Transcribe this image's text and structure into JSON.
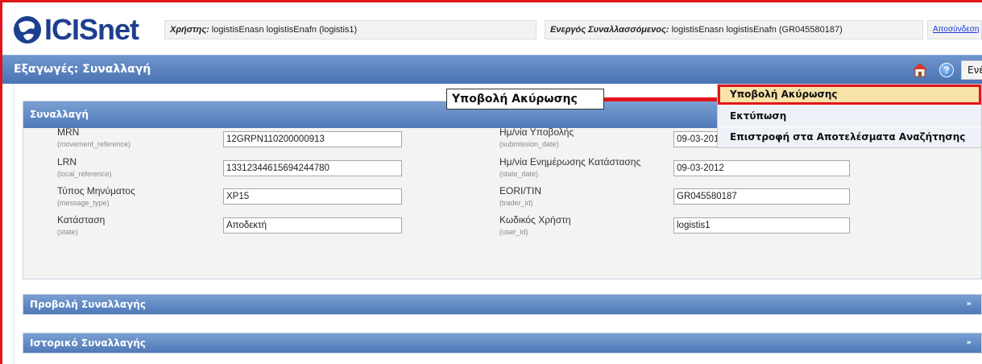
{
  "header": {
    "brand": "ICISnet",
    "user_label": "Χρήστης:",
    "user_value": " logistisEnasn logistisEnafn (logistis1)",
    "trader_label": "Ενεργός Συναλλασσόμενος:",
    "trader_value": " logistisEnasn logistisEnafn (GR045580187)",
    "logout": "Αποσύνδεση"
  },
  "titlebar": {
    "title": "Εξαγωγές: Συναλλαγή",
    "actions": "Ενέργειες"
  },
  "menu": {
    "items": [
      "Υποβολή Ακύρωσης",
      "Εκτύπωση",
      "Επιστροφή στα Αποτελέσματα Αναζήτησης"
    ]
  },
  "callout": "Υποβολή Ακύρωσης",
  "panel": {
    "title": "Συναλλαγή",
    "left_fields": [
      {
        "label": "MRN",
        "sub": "(movement_reference)",
        "value": "12GRPN110200000913"
      },
      {
        "label": "LRN",
        "sub": "(local_reference)",
        "value": "13312344615694244780"
      },
      {
        "label": "Τύπος Μηνύματος",
        "sub": "(message_type)",
        "value": "XP15"
      },
      {
        "label": "Κατάσταση",
        "sub": "(state)",
        "value": "Αποδεκτή"
      }
    ],
    "right_fields": [
      {
        "label": "Ημ/νία Υποβολής",
        "sub": "(submission_date)",
        "value": "09-03-2012"
      },
      {
        "label": "Ημ/νία Ενημέρωσης Κατάστασης",
        "sub": "(state_date)",
        "value": "09-03-2012"
      },
      {
        "label": "EORI/TIN",
        "sub": "(trader_id)",
        "value": "GR045580187"
      },
      {
        "label": "Κωδικός Χρήστη",
        "sub": "(user_id)",
        "value": "logistis1"
      }
    ]
  },
  "collapsed_panels": [
    {
      "title": "Προβολή Συναλλαγής",
      "chevron": "»"
    },
    {
      "title": "Ιστορικό Συναλλαγής",
      "chevron": "»"
    }
  ],
  "colors": {
    "accent": "#4f78b7",
    "highlight": "#e1141b",
    "menu_selected": "#f7e3a8"
  }
}
